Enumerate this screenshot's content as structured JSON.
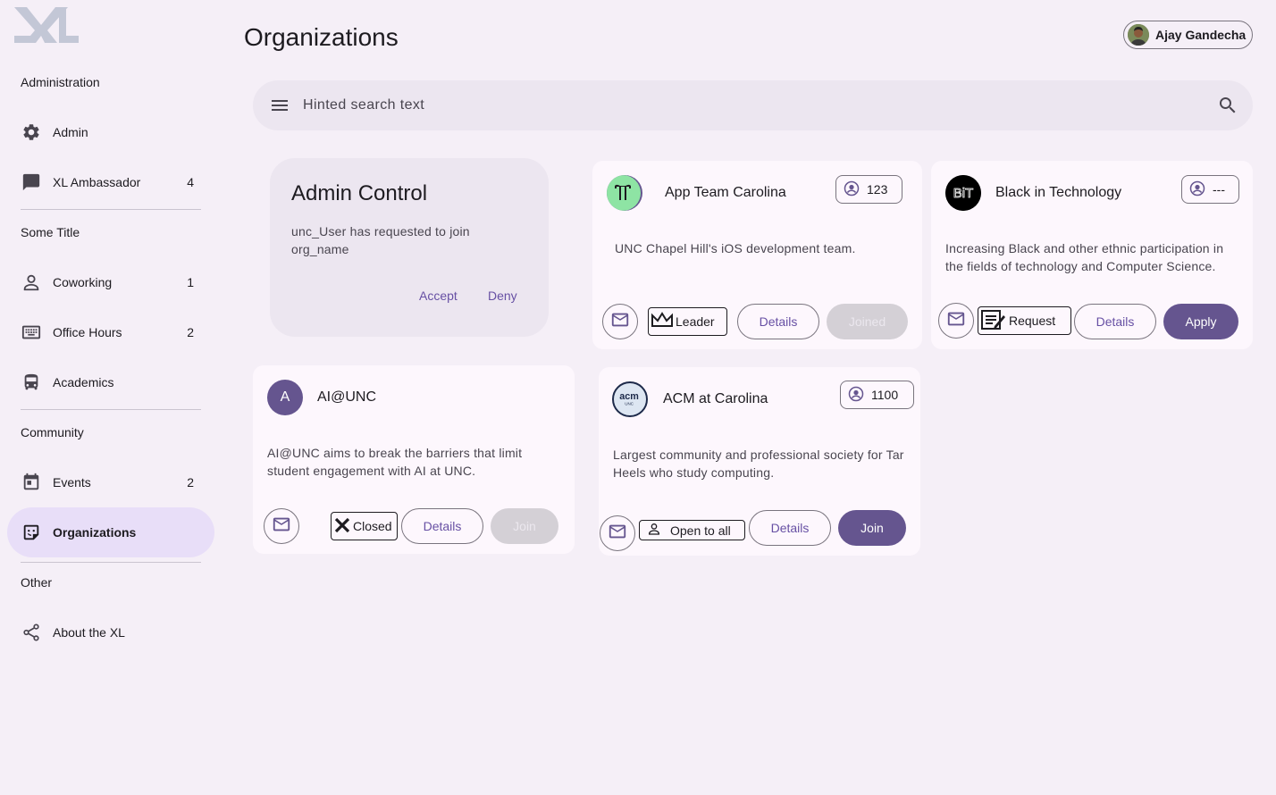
{
  "brand": {
    "logo_text": "XL"
  },
  "sidebar": {
    "sections": [
      {
        "title": "Administration"
      },
      {
        "title": "Some Title"
      },
      {
        "title": "Community"
      },
      {
        "title": "Other"
      }
    ],
    "items": [
      {
        "label": "Admin",
        "badge": "",
        "icon": "gear-icon"
      },
      {
        "label": "XL Ambassador",
        "badge": "4",
        "icon": "chat-icon"
      },
      {
        "label": "Coworking",
        "badge": "1",
        "icon": "person-icon"
      },
      {
        "label": "Office Hours",
        "badge": "2",
        "icon": "keyboard-icon"
      },
      {
        "label": "Academics",
        "badge": "",
        "icon": "bus-icon"
      },
      {
        "label": "Events",
        "badge": "2",
        "icon": "calendar-icon"
      },
      {
        "label": "Organizations",
        "badge": "",
        "icon": "sticky-note-icon",
        "active": true
      },
      {
        "label": "About the XL",
        "badge": "",
        "icon": "share-icon"
      }
    ]
  },
  "header": {
    "title": "Organizations",
    "user_name": "Ajay Gandecha"
  },
  "search": {
    "placeholder": "Hinted search text"
  },
  "admin_card": {
    "title": "Admin Control",
    "body": "unc_User has requested to join org_name",
    "accept_label": "Accept",
    "deny_label": "Deny"
  },
  "orgs": [
    {
      "name": "App Team Carolina",
      "members": "123",
      "description": "UNC Chapel Hill's iOS development team.",
      "status": "Leader",
      "details_label": "Details",
      "action_label": "Joined",
      "action_state": "disabled"
    },
    {
      "name": "Black in Technology",
      "members": "---",
      "description": "Increasing Black and other ethnic participation in the fields of technology and Computer Science.",
      "status": "Request",
      "details_label": "Details",
      "action_label": "Apply",
      "action_state": "filled"
    },
    {
      "name": "AI@UNC",
      "avatar_letter": "A",
      "description": "AI@UNC aims to break the barriers that limit student engagement with AI at UNC.",
      "status": "Closed",
      "details_label": "Details",
      "action_label": "Join",
      "action_state": "disabled"
    },
    {
      "name": "ACM at Carolina",
      "avatar_text": "acm",
      "avatar_sub": "UNC",
      "members": "1100",
      "description": "Largest community and professional society for Tar Heels who study computing.",
      "status": "Open to all",
      "details_label": "Details",
      "action_label": "Join",
      "action_state": "filled"
    }
  ],
  "colors": {
    "background": "#f5eff7",
    "primary": "#65558f",
    "active_nav": "#e8def8",
    "card": "#fdf7fd"
  }
}
